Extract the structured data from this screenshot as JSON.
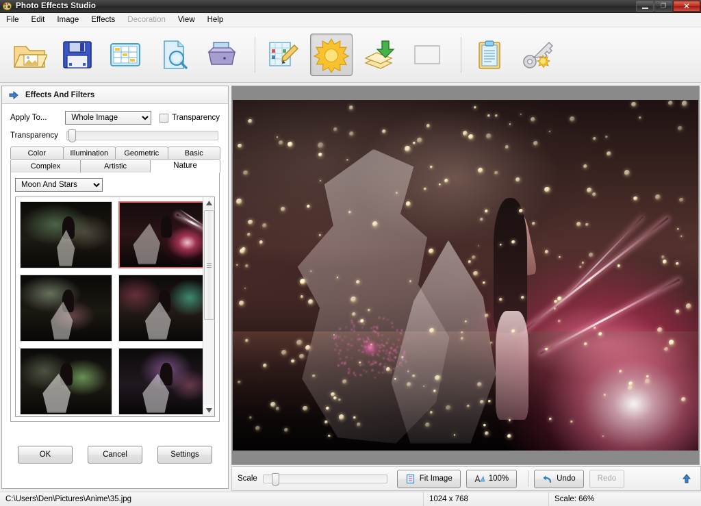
{
  "window": {
    "title": "Photo Effects Studio",
    "app_icon": "palette-icon",
    "controls": {
      "minimize": "minimize-icon",
      "restore": "restore-icon",
      "close": "close-icon"
    }
  },
  "menu": {
    "items": [
      {
        "label": "File",
        "enabled": true
      },
      {
        "label": "Edit",
        "enabled": true
      },
      {
        "label": "Image",
        "enabled": true
      },
      {
        "label": "Effects",
        "enabled": true
      },
      {
        "label": "Decoration",
        "enabled": false
      },
      {
        "label": "View",
        "enabled": true
      },
      {
        "label": "Help",
        "enabled": true
      }
    ]
  },
  "toolbar": {
    "buttons": [
      {
        "name": "open-image-button",
        "icon": "open-folder-icon",
        "active": false
      },
      {
        "name": "save-image-button",
        "icon": "floppy-save-icon",
        "active": false
      },
      {
        "name": "batch-processing-button",
        "icon": "grid-table-icon",
        "active": false
      },
      {
        "name": "preview-button",
        "icon": "document-magnifier-icon",
        "active": false
      },
      {
        "name": "print-button",
        "icon": "printer-icon",
        "active": false
      },
      {
        "name": "edit-palette-button",
        "icon": "palette-pencil-icon",
        "active": false
      },
      {
        "name": "effects-filters-button",
        "icon": "sun-icon",
        "active": true
      },
      {
        "name": "layers-import-button",
        "icon": "layers-download-icon",
        "active": false
      },
      {
        "name": "frame-button",
        "icon": "empty-frame-icon",
        "active": false
      },
      {
        "name": "clipboard-button",
        "icon": "clipboard-icon",
        "active": false
      },
      {
        "name": "key-settings-button",
        "icon": "key-sun-icon",
        "active": false
      }
    ]
  },
  "panel": {
    "header_icon": "blue-arrow-right-icon",
    "title": "Effects And Filters",
    "apply_to_label": "Apply To...",
    "apply_to_value": "Whole Image",
    "apply_to_options": [
      "Whole Image"
    ],
    "transparency_checkbox_label": "Transparency",
    "transparency_checked": false,
    "transparency_slider_label": "Transparency",
    "transparency_slider_value": 0,
    "tabs_row1": [
      {
        "label": "Color",
        "selected": false
      },
      {
        "label": "Illumination",
        "selected": false
      },
      {
        "label": "Geometric",
        "selected": false
      },
      {
        "label": "Basic",
        "selected": false
      }
    ],
    "tabs_row2": [
      {
        "label": "Complex",
        "selected": false
      },
      {
        "label": "Artistic",
        "selected": false
      },
      {
        "label": "Nature",
        "selected": true
      }
    ],
    "effect_select_value": "Moon And Stars",
    "effect_select_options": [
      "Moon And Stars"
    ],
    "thumbnails": [
      {
        "name": "effect-thumbnail-1",
        "selected": false,
        "tint": "green"
      },
      {
        "name": "effect-thumbnail-2",
        "selected": true,
        "tint": "pink-ray"
      },
      {
        "name": "effect-thumbnail-3",
        "selected": false,
        "tint": "pale-green"
      },
      {
        "name": "effect-thumbnail-4",
        "selected": false,
        "tint": "teal-magenta"
      },
      {
        "name": "effect-thumbnail-5",
        "selected": false,
        "tint": "lime"
      },
      {
        "name": "effect-thumbnail-6",
        "selected": false,
        "tint": "violet"
      },
      {
        "name": "effect-thumbnail-7",
        "selected": false,
        "tint": "dark"
      },
      {
        "name": "effect-thumbnail-8",
        "selected": false,
        "tint": "emerald"
      }
    ],
    "buttons": {
      "ok": "OK",
      "cancel": "Cancel",
      "settings": "Settings"
    }
  },
  "bottom_bar": {
    "scale_label": "Scale",
    "scale_slider_value": 6,
    "fit_image_label": "Fit Image",
    "fit_image_icon": "fit-page-icon",
    "zoom_100_label": "100%",
    "zoom_100_icon": "actual-size-icon",
    "undo_label": "Undo",
    "undo_icon": "undo-arrow-icon",
    "undo_enabled": true,
    "redo_label": "Redo",
    "redo_icon": "redo-arrow-icon",
    "redo_enabled": false,
    "collapse_icon": "blue-arrow-up-icon"
  },
  "statusbar": {
    "file_path": "C:\\Users\\Den\\Pictures\\Anime\\35.jpg",
    "dimensions": "1024 x 768",
    "scale": "Scale: 66%"
  },
  "colors": {
    "accent_blue": "#2f6fba",
    "selection_red": "#e06a6a",
    "close_red": "#c03020",
    "canvas_gray": "#8a8a8a"
  }
}
